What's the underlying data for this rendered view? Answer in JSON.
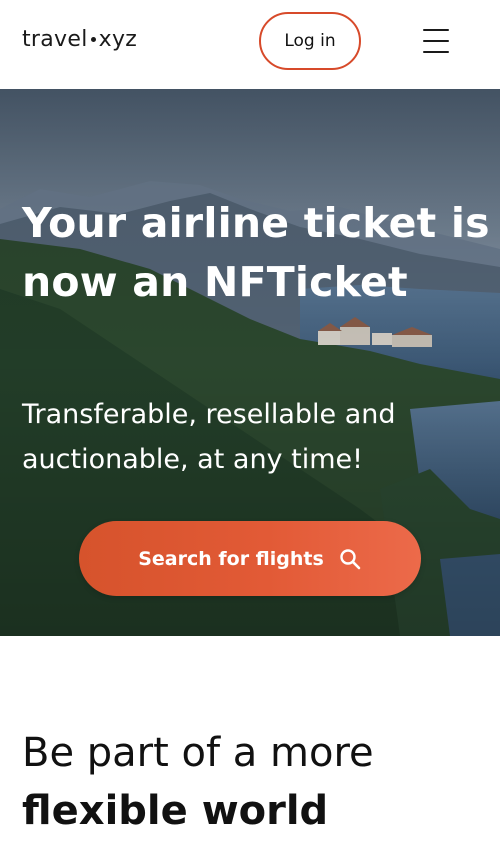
{
  "header": {
    "logo_left": "travel",
    "logo_right": "xyz",
    "login_label": "Log in",
    "menu_icon": "hamburger-menu-icon"
  },
  "hero": {
    "title": "Your airline ticket is now an NFTicket",
    "subtitle": "Transferable, resellable and auctionable, at any time!",
    "search_label": "Search for flights",
    "search_icon": "search-icon",
    "button_color_start": "#d6532c",
    "button_color_end": "#ec6a4a"
  },
  "section": {
    "heading_light": "Be part of a more",
    "heading_bold": "flexible world"
  },
  "colors": {
    "accent": "#d74a2a",
    "text": "#111111",
    "hero_text": "#ffffff"
  }
}
